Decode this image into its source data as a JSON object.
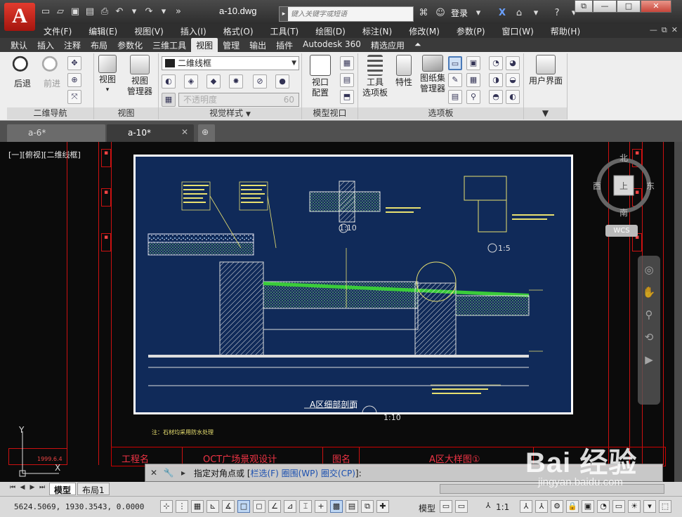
{
  "app": {
    "logo": "A",
    "filename": "a-10.dwg",
    "search_placeholder": "键入关键字或短语",
    "login": "登录",
    "window_controls": {
      "minimize": "—",
      "maximize": "□",
      "close": "✕"
    }
  },
  "menu": [
    "文件(F)",
    "编辑(E)",
    "视图(V)",
    "插入(I)",
    "格式(O)",
    "工具(T)",
    "绘图(D)",
    "标注(N)",
    "修改(M)",
    "参数(P)",
    "窗口(W)",
    "帮助(H)"
  ],
  "ribbon_tabs": [
    "默认",
    "插入",
    "注释",
    "布局",
    "参数化",
    "三维工具",
    "视图",
    "管理",
    "输出",
    "插件",
    "Autodesk 360",
    "精选应用"
  ],
  "active_ribbon_tab": "视图",
  "ribbon": {
    "nav2d": {
      "back": "后退",
      "forward": "前进",
      "title": "二维导航"
    },
    "view": {
      "view_btn": "视图",
      "view_manager_1": "视图",
      "view_manager_2": "管理器",
      "title": "视图"
    },
    "visual_styles": {
      "current": "二维线框",
      "opacity_placeholder": "不透明度",
      "opacity_value": "60",
      "title": "视觉样式"
    },
    "model_viewports": {
      "config_1": "视口",
      "config_2": "配置",
      "title": "模型视口"
    },
    "palettes": {
      "tool_1": "工具",
      "tool_2": "选项板",
      "properties": "特性",
      "sheetset_1": "图纸集",
      "sheetset_2": "管理器",
      "title": "选项板"
    },
    "ui": {
      "label": "用户界面"
    }
  },
  "doc_tabs": [
    {
      "label": "a-6*",
      "active": false
    },
    {
      "label": "a-10*",
      "active": true
    }
  ],
  "viewport_label": "[一][俯视][二维线框]",
  "compass": {
    "north": "北",
    "south": "南",
    "east": "东",
    "west": "西",
    "top": "上",
    "wcs": "WCS"
  },
  "drawing": {
    "section_title": "A区细部剖面",
    "scale_main": "1:10",
    "detail_2": "1:5",
    "detail_3": "1:10",
    "titleblock": {
      "label_name": "工程名",
      "project": "OCT广场景观设计",
      "label_drawing": "图名",
      "drawing_name": "A区大样图①"
    },
    "note": "注：石材均采用防水处理",
    "year": "1999.6.4"
  },
  "command": {
    "prompt": "指定对角点或 [",
    "opt1": "栏选(F)",
    "opt2": "圈围(WP)",
    "opt3": "圈交(CP)",
    "end": "]:"
  },
  "layout_tabs": [
    {
      "label": "模型",
      "active": true
    },
    {
      "label": "布局1",
      "active": false
    }
  ],
  "status": {
    "coords": "5624.5069, 1930.3543, 0.0000",
    "model": "模型",
    "scale": "1:1"
  },
  "watermark": {
    "logo": "Bai 经验",
    "url": "jingyan.baidu.com"
  }
}
